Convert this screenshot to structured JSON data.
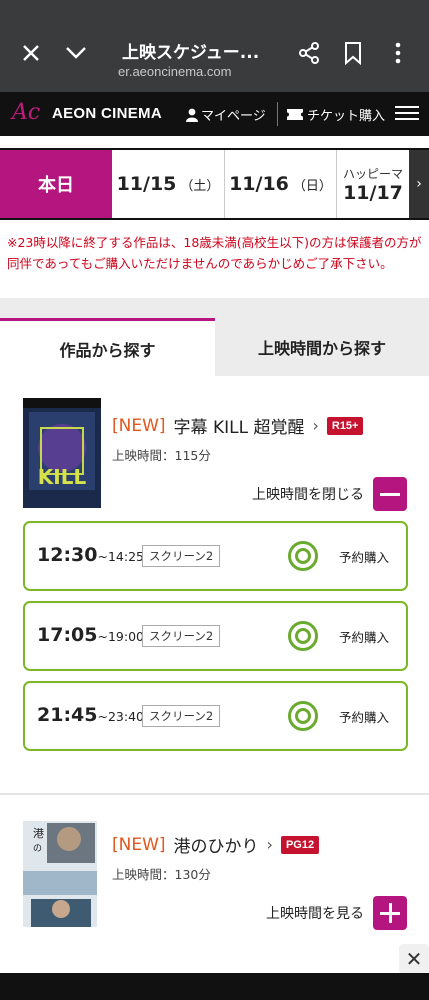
{
  "browser": {
    "title": "上映スケジュー...",
    "url": "er.aeoncinema.com"
  },
  "header": {
    "logo_mark": "Ac",
    "logo_text": "AEON CINEMA",
    "mypage": "マイページ",
    "ticket": "チケット購入"
  },
  "dates": {
    "today": "本日",
    "d1": "11/15",
    "d1_day": "（土）",
    "d2": "11/16",
    "d2_day": "（日）",
    "d3_label": "ハッピーマ",
    "d3": "11/17"
  },
  "notice": "※23時以降に終了する作品は、18歳未満(高校生以下)の方は保護者の方が同伴であってもご購入いただけませんのであらかじめご了承下さい。",
  "tabs": {
    "by_movie": "作品から探す",
    "by_time": "上映時間から探す"
  },
  "movies": [
    {
      "new": "[NEW]",
      "title": "字幕 KILL 超覚醒",
      "rating": "R15+",
      "runtime": "上映時間：115分",
      "toggle": "上映時間を閉じる",
      "slots": [
        {
          "start": "12:30",
          "end": "~14:25",
          "screen": "スクリーン2",
          "buy": "予約購入"
        },
        {
          "start": "17:05",
          "end": "~19:00",
          "screen": "スクリーン2",
          "buy": "予約購入"
        },
        {
          "start": "21:45",
          "end": "~23:40",
          "screen": "スクリーン2",
          "buy": "予約購入"
        }
      ]
    },
    {
      "new": "[NEW]",
      "title": "港のひかり",
      "rating": "PG12",
      "runtime": "上映時間：130分",
      "toggle": "上映時間を見る"
    }
  ],
  "colors": {
    "brand": "#b5157f",
    "available": "#6aaa2e",
    "notice": "#d0021b",
    "rating": "#c4122f",
    "new": "#e2571f"
  }
}
